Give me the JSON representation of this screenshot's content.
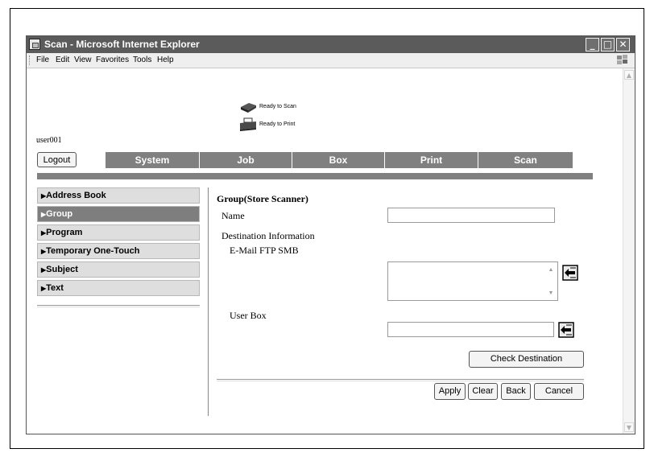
{
  "window": {
    "title": "Scan - Microsoft Internet Explorer",
    "minimize": "_",
    "maximize": "□",
    "close": "✕"
  },
  "menu": {
    "items": [
      {
        "label": "File"
      },
      {
        "label": "Edit"
      },
      {
        "label": "View"
      },
      {
        "label": "Favorites"
      },
      {
        "label": "Tools"
      },
      {
        "label": "Help"
      }
    ]
  },
  "status": {
    "scanner": "Ready to Scan",
    "printer": "Ready to Print"
  },
  "user": {
    "name": "user001",
    "logout_label": "Logout"
  },
  "tabs": [
    {
      "label": "System"
    },
    {
      "label": "Job"
    },
    {
      "label": "Box"
    },
    {
      "label": "Print"
    },
    {
      "label": "Scan"
    }
  ],
  "sidebar": {
    "items": [
      {
        "arrow": "▶",
        "label": "Address Book",
        "active": false
      },
      {
        "arrow": "▶",
        "label": "Group",
        "active": true
      },
      {
        "arrow": "▶",
        "label": "Program",
        "active": false
      },
      {
        "arrow": "▶",
        "label": "Temporary One-Touch",
        "active": false
      },
      {
        "arrow": "▶",
        "label": "Subject",
        "active": false
      },
      {
        "arrow": "▶",
        "label": "Text",
        "active": false
      }
    ]
  },
  "form": {
    "title": "Group(Store Scanner)",
    "name_label": "Name",
    "name_value": "",
    "dest_info_label": "Destination Information",
    "dest_types_label": "E-Mail FTP SMB",
    "dest_value": "",
    "userbox_label": "User Box",
    "userbox_value": "",
    "check_dest_label": "Check Destination",
    "apply_label": "Apply",
    "clear_label": "Clear",
    "back_label": "Back",
    "cancel_label": "Cancel"
  },
  "colors": {
    "titlebar": "#5b5b5b",
    "tab_bg": "#808080",
    "sidebar_active": "#7e7e7e",
    "sidebar_bg": "#dedede"
  }
}
